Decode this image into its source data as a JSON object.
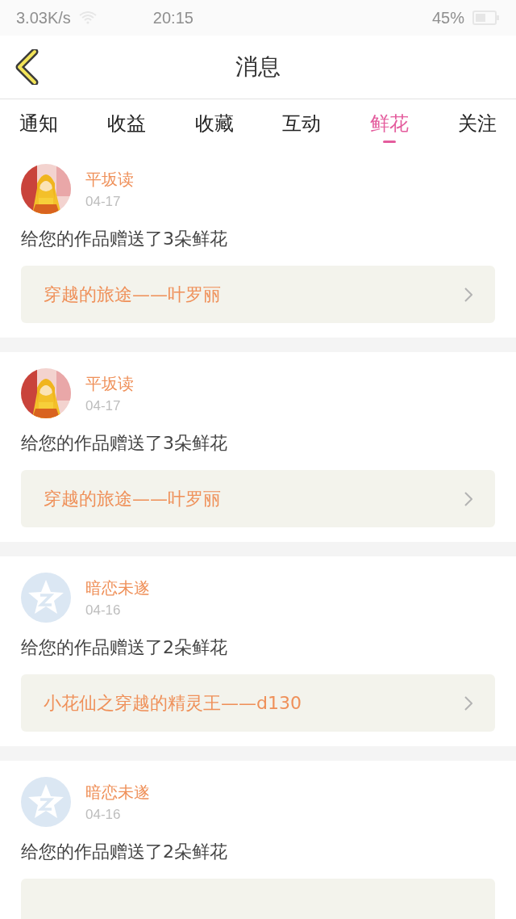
{
  "status_bar": {
    "speed": "3.03K/s",
    "time": "20:15",
    "battery": "45%"
  },
  "header": {
    "title": "消息"
  },
  "tabs": [
    {
      "label": "通知",
      "selected": false
    },
    {
      "label": "收益",
      "selected": false
    },
    {
      "label": "收藏",
      "selected": false
    },
    {
      "label": "互动",
      "selected": false
    },
    {
      "label": "鲜花",
      "selected": true
    },
    {
      "label": "关注",
      "selected": false
    }
  ],
  "messages": [
    {
      "name": "平坂读",
      "date": "04-17",
      "text": "给您的作品赠送了3朵鲜花",
      "link": "穿越的旅途——叶罗丽"
    },
    {
      "name": "平坂读",
      "date": "04-17",
      "text": "给您的作品赠送了3朵鲜花",
      "link": "穿越的旅途——叶罗丽"
    },
    {
      "avatar": {
        "kind": "default"
      },
      "name": "暗恋未遂",
      "date": "04-16",
      "text": "给您的作品赠送了2朵鲜花",
      "link": "小花仙之穿越的精灵王——d130"
    },
    {
      "avatar": {
        "kind": "default"
      },
      "name": "暗恋未遂",
      "date": "04-16",
      "text": "给您的作品赠送了2朵鲜花"
    }
  ]
}
